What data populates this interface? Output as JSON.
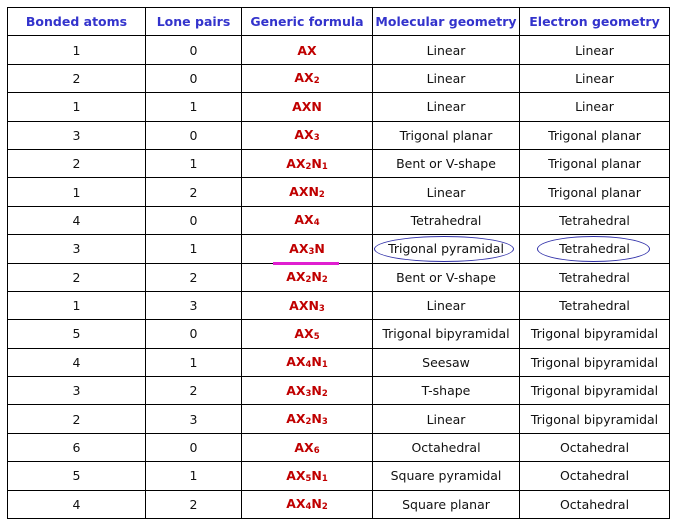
{
  "table": {
    "headers": [
      "Bonded atoms",
      "Lone pairs",
      "Generic formula",
      "Molecular geometry",
      "Electron geometry"
    ],
    "rows": [
      {
        "bonded": "1",
        "lone": "0",
        "formula": [
          [
            "AX",
            ""
          ]
        ],
        "molecular": "Linear",
        "electron": "Linear"
      },
      {
        "bonded": "2",
        "lone": "0",
        "formula": [
          [
            "AX",
            "2"
          ]
        ],
        "molecular": "Linear",
        "electron": "Linear"
      },
      {
        "bonded": "1",
        "lone": "1",
        "formula": [
          [
            "AXN",
            ""
          ]
        ],
        "molecular": "Linear",
        "electron": "Linear"
      },
      {
        "bonded": "3",
        "lone": "0",
        "formula": [
          [
            "AX",
            "3"
          ]
        ],
        "molecular": "Trigonal planar",
        "electron": "Trigonal planar"
      },
      {
        "bonded": "2",
        "lone": "1",
        "formula": [
          [
            "AX",
            "2"
          ],
          [
            "N",
            "1"
          ]
        ],
        "molecular": "Bent or V-shape",
        "electron": "Trigonal planar"
      },
      {
        "bonded": "1",
        "lone": "2",
        "formula": [
          [
            "AXN",
            "2"
          ]
        ],
        "molecular": "Linear",
        "electron": "Trigonal planar"
      },
      {
        "bonded": "4",
        "lone": "0",
        "formula": [
          [
            "AX",
            "4"
          ]
        ],
        "molecular": "Tetrahedral",
        "electron": "Tetrahedral"
      },
      {
        "bonded": "3",
        "lone": "1",
        "formula": [
          [
            "AX",
            "3"
          ],
          [
            "N",
            ""
          ]
        ],
        "molecular": "Trigonal pyramidal",
        "electron": "Tetrahedral",
        "highlight": true
      },
      {
        "bonded": "2",
        "lone": "2",
        "formula": [
          [
            "AX",
            "2"
          ],
          [
            "N",
            "2"
          ]
        ],
        "molecular": "Bent or V-shape",
        "electron": "Tetrahedral"
      },
      {
        "bonded": "1",
        "lone": "3",
        "formula": [
          [
            "AXN",
            "3"
          ]
        ],
        "molecular": "Linear",
        "electron": "Tetrahedral"
      },
      {
        "bonded": "5",
        "lone": "0",
        "formula": [
          [
            "AX",
            "5"
          ]
        ],
        "molecular": "Trigonal bipyramidal",
        "electron": "Trigonal bipyramidal"
      },
      {
        "bonded": "4",
        "lone": "1",
        "formula": [
          [
            "AX",
            "4"
          ],
          [
            "N",
            "1"
          ]
        ],
        "molecular": "Seesaw",
        "electron": "Trigonal bipyramidal"
      },
      {
        "bonded": "3",
        "lone": "2",
        "formula": [
          [
            "AX",
            "3"
          ],
          [
            "N",
            "2"
          ]
        ],
        "molecular": "T-shape",
        "electron": "Trigonal bipyramidal"
      },
      {
        "bonded": "2",
        "lone": "3",
        "formula": [
          [
            "AX",
            "2"
          ],
          [
            "N",
            "3"
          ]
        ],
        "molecular": "Linear",
        "electron": "Trigonal bipyramidal"
      },
      {
        "bonded": "6",
        "lone": "0",
        "formula": [
          [
            "AX",
            "6"
          ]
        ],
        "molecular": "Octahedral",
        "electron": "Octahedral"
      },
      {
        "bonded": "5",
        "lone": "1",
        "formula": [
          [
            "AX",
            "5"
          ],
          [
            "N",
            "1"
          ]
        ],
        "molecular": "Square pyramidal",
        "electron": "Octahedral"
      },
      {
        "bonded": "4",
        "lone": "2",
        "formula": [
          [
            "AX",
            "4"
          ],
          [
            "N",
            "2"
          ]
        ],
        "molecular": "Square planar",
        "electron": "Octahedral"
      }
    ]
  },
  "colors": {
    "header": "#3333cc",
    "formula": "#c00000",
    "underline": "#e01fd0",
    "circle": "#3333aa"
  }
}
